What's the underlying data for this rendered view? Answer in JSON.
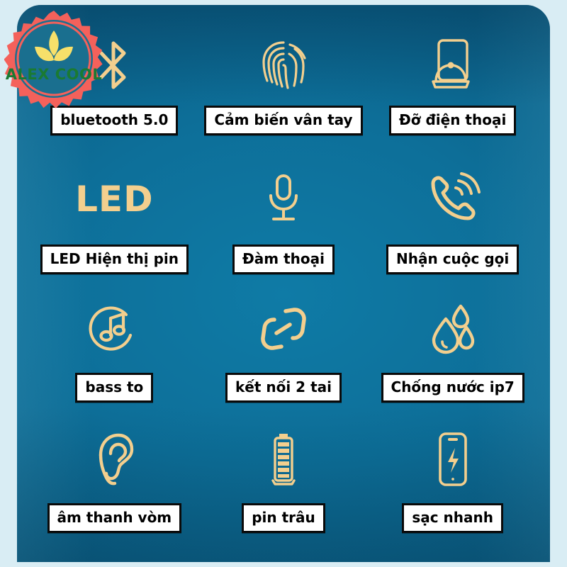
{
  "poster": {
    "background_color": "#d9edf4",
    "card_gradient_from": "#0f7ba6",
    "card_gradient_to": "#0a4f71",
    "icon_color": "#f3cf8e",
    "label_text_color": "#000000",
    "label_background": "#ffffff",
    "label_border_color": "#0a0a0a"
  },
  "badge": {
    "brand": "ALEX COOL",
    "starburst_color": "#f4615b",
    "inner_circle_color": "#1a6f8f",
    "leaf_color": "#f7e06a",
    "text_color": "#1a7a33"
  },
  "features": [
    [
      {
        "icon": "bluetooth-icon",
        "label": "bluetooth 5.0"
      },
      {
        "icon": "fingerprint-icon",
        "label": "Cảm biến vân tay"
      },
      {
        "icon": "phone-holder-icon",
        "label": "Đỡ điện thoại"
      }
    ],
    [
      {
        "icon": "led-text-icon",
        "icon_text": "LED",
        "label": "LED Hiện thị pin"
      },
      {
        "icon": "microphone-icon",
        "label": "Đàm thoại"
      },
      {
        "icon": "incoming-call-icon",
        "label": "Nhận cuộc gọi"
      }
    ],
    [
      {
        "icon": "music-note-circle-icon",
        "label": "bass to"
      },
      {
        "icon": "link-chain-icon",
        "label": "kết nối 2 tai"
      },
      {
        "icon": "water-drops-icon",
        "label": "Chống nước ip7"
      }
    ],
    [
      {
        "icon": "ear-icon",
        "label": "âm thanh vòm"
      },
      {
        "icon": "battery-icon",
        "label": "pin trâu"
      },
      {
        "icon": "fast-charge-phone-icon",
        "label": "sạc nhanh"
      }
    ]
  ]
}
